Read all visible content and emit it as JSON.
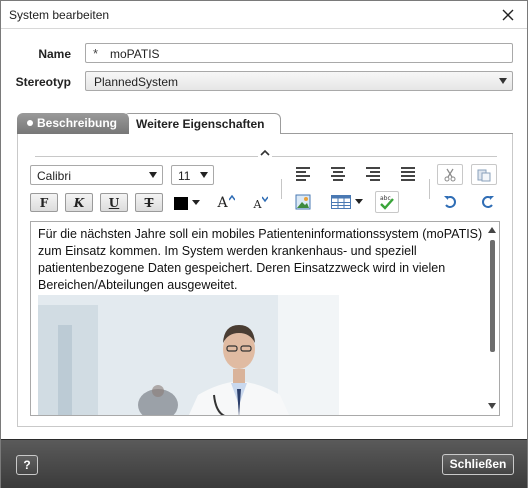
{
  "window": {
    "title": "System bearbeiten"
  },
  "form": {
    "name_label": "Name",
    "name_prefix": "*",
    "name_value": "moPATIS",
    "stereotype_label": "Stereotyp",
    "stereotype_value": "PlannedSystem"
  },
  "tabs": [
    {
      "label": "Beschreibung",
      "active": true
    },
    {
      "label": "Weitere Eigenschaften",
      "active": false
    }
  ],
  "toolbar": {
    "collapse_glyph": "^",
    "font_family": "Calibri",
    "font_size": "11",
    "bold_label": "F",
    "italic_label": "K",
    "underline_label": "U",
    "strikethrough_label": "T",
    "grow_font_label": "A",
    "shrink_font_label": "A",
    "text_color": "#000000",
    "icons": [
      "align-left-icon",
      "align-center-icon",
      "align-right-icon",
      "justify-icon",
      "cut-icon",
      "paste-icon",
      "image-icon",
      "table-icon",
      "spellcheck-icon",
      "undo-icon",
      "redo-icon"
    ]
  },
  "editor": {
    "text": "Für die nächsten Jahre soll ein mobiles Patienteninformationssystem (moPATIS) zum Einsatz kommen. Im System werden krankenhaus- und speziell patientenbezogene Daten gespeichert. Deren Einsatzzweck wird in vielen Bereichen/Abteilungen ausgeweitet."
  },
  "footer": {
    "help_label": "?",
    "close_label": "Schließen"
  },
  "colors": {
    "footer_bg": "#474747",
    "active_tab": "#8a8a8a",
    "icon_blue": "#2f6db5",
    "spell_green": "#3aa53a"
  }
}
